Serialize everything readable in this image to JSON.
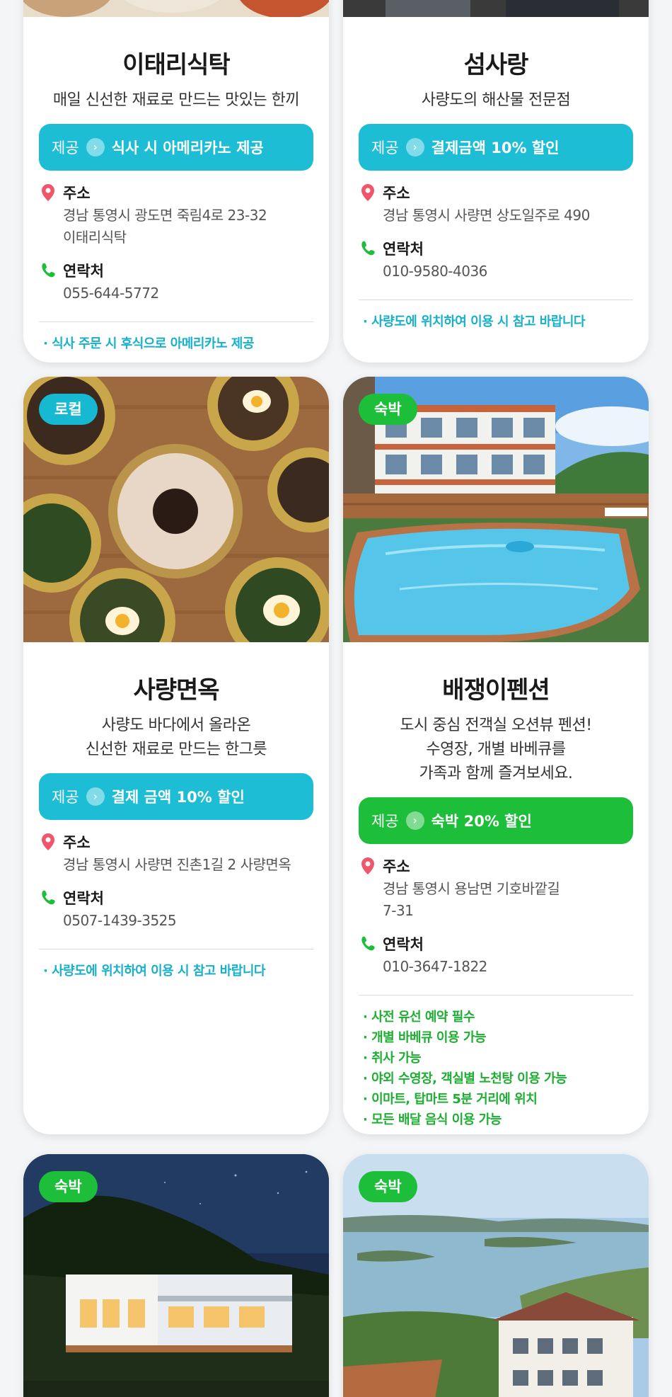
{
  "cards": [
    {
      "title": "이태리식탁",
      "desc": [
        "매일 신선한 재료로 만드는 맛있는 한끼"
      ],
      "offer_label": "제공",
      "offer_text": "식사 시 아메리카노 제공",
      "address_label": "주소",
      "address": [
        "경남 통영시 광도면 죽림4로 23-32",
        "이태리식탁"
      ],
      "contact_label": "연락처",
      "contact": "055-644-5772",
      "notes": [
        "· 식사 주문 시 후식으로 아메리카노 제공"
      ]
    },
    {
      "title": "섬사랑",
      "desc": [
        "사량도의 해산물 전문점"
      ],
      "offer_label": "제공",
      "offer_text": "결제금액 10% 할인",
      "address_label": "주소",
      "address": [
        "경남 통영시 사량면 상도일주로 490"
      ],
      "contact_label": "연락처",
      "contact": "010-9580-4036",
      "notes": [
        "· 사량도에 위치하여 이용 시 참고 바랍니다"
      ]
    },
    {
      "badge": "로컬",
      "title": "사량면옥",
      "desc": [
        "사량도 바다에서 올라온",
        "신선한 재료로 만드는 한그릇"
      ],
      "offer_label": "제공",
      "offer_text": "결제 금액 10% 할인",
      "address_label": "주소",
      "address": [
        "경남 통영시 사량면 진촌1길 2 사량면옥"
      ],
      "contact_label": "연락처",
      "contact": "0507-1439-3525",
      "notes": [
        "· 사량도에 위치하여 이용 시 참고 바랍니다"
      ]
    },
    {
      "badge": "숙박",
      "title": "배쟁이펜션",
      "desc": [
        "도시 중심 전객실 오션뷰 펜션!",
        "수영장, 개별 바베큐를",
        "가족과 함께 즐겨보세요."
      ],
      "offer_label": "제공",
      "offer_text": "숙박 20% 할인",
      "address_label": "주소",
      "address": [
        "경남 통영시 용남면 기호바깥길",
        "7-31"
      ],
      "contact_label": "연락처",
      "contact": "010-3647-1822",
      "notes": [
        "· 사전 유선 예약 필수",
        "· 개별 바베큐 이용 가능",
        "· 취사 가능",
        "· 야외 수영장, 객실별 노천탕 이용 가능",
        "· 이마트, 탑마트 5분 거리에 위치",
        "· 모든 배달 음식 이용 가능"
      ]
    },
    {
      "badge": "숙박"
    },
    {
      "badge": "숙박"
    }
  ],
  "colors": {
    "blue": "#1cbdd5",
    "green": "#1dbe39"
  }
}
